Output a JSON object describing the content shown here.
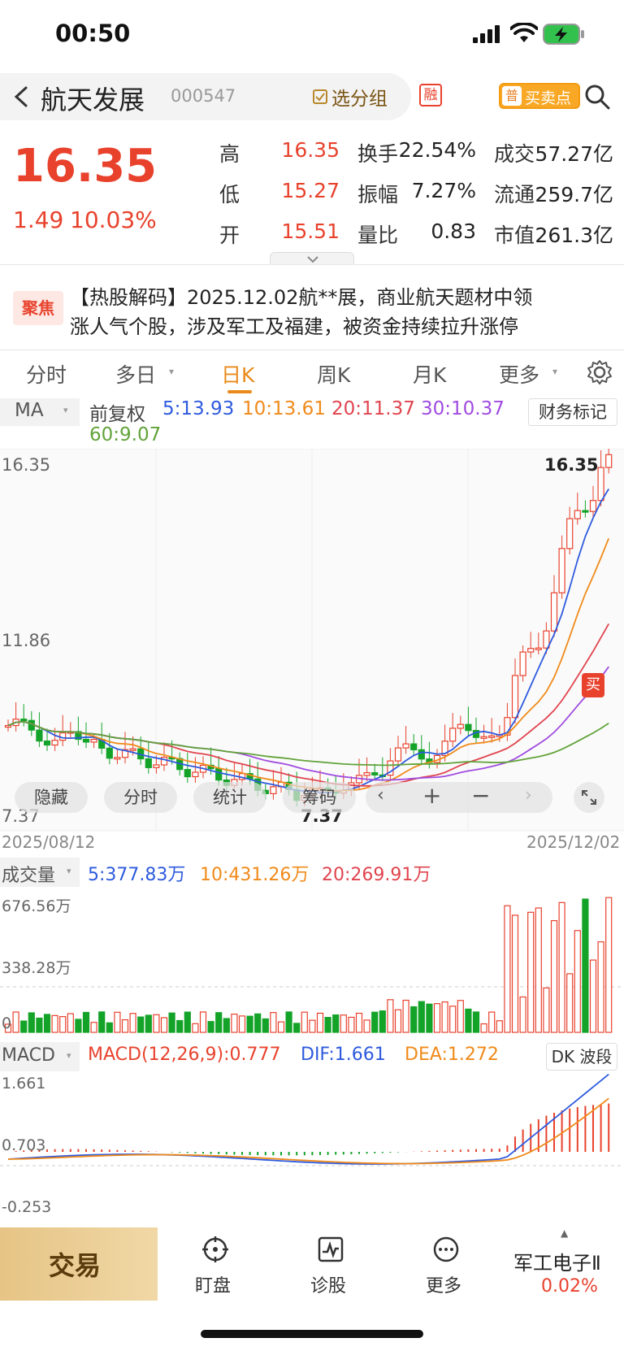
{
  "status_bar": {
    "time": "00:50"
  },
  "header": {
    "stock_name": "航天发展",
    "stock_code": "000547",
    "add_group_label": "选分组",
    "margin_badge": "融",
    "buy_sell_prefix": "普",
    "buy_sell_label": "买卖点"
  },
  "quote": {
    "price": "16.35",
    "change": "1.49",
    "change_pct": "10.03%",
    "rows": [
      {
        "l1": "高",
        "v1": "16.35",
        "l2": "换手",
        "v2": "22.54%",
        "l3": "成交",
        "v3": "57.27亿"
      },
      {
        "l1": "低",
        "v1": "15.27",
        "l2": "振幅",
        "v2": "7.27%",
        "l3": "流通",
        "v3": "259.7亿"
      },
      {
        "l1": "开",
        "v1": "15.51",
        "l2": "量比",
        "v2": "0.83",
        "l3": "市值",
        "v3": "261.3亿"
      }
    ]
  },
  "news": {
    "badge": "聚焦",
    "line1": "【热股解码】2025.12.02航**展，商业航天题材中领",
    "line2": "涨人气个股，涉及军工及福建，被资金持续拉升涨停"
  },
  "tabs": [
    {
      "label": "分时",
      "active": false
    },
    {
      "label": "多日",
      "active": false,
      "dropdown": true
    },
    {
      "label": "日K",
      "active": true
    },
    {
      "label": "周K",
      "active": false
    },
    {
      "label": "月K",
      "active": false
    },
    {
      "label": "更多",
      "active": false,
      "dropdown": true
    }
  ],
  "ma_legend": {
    "selector": "MA",
    "adjust": "前复权",
    "ma5": "5:13.93",
    "ma10": "10:13.61",
    "ma20": "20:11.37",
    "ma30": "30:10.37",
    "ma60": "60:9.07",
    "finance_mark": "财务标记"
  },
  "kline": {
    "y_high": "16.35",
    "y_mid": "11.86",
    "y_low": "7.37",
    "max_label": "16.35",
    "min_label": "7.37",
    "date_start": "2025/08/12",
    "date_end": "2025/12/02",
    "buy_marker": "买",
    "overlay_buttons": [
      "隐藏",
      "分时",
      "统计",
      "筹码"
    ]
  },
  "volume": {
    "selector": "成交量",
    "ma5": "5:377.83万",
    "ma10": "10:431.26万",
    "ma20": "20:269.91万",
    "y_top": "676.56万",
    "y_mid": "338.28万",
    "y_bottom": "0"
  },
  "macd": {
    "selector": "MACD",
    "macd_label": "MACD(12,26,9):0.777",
    "dif_label": "DIF:1.661",
    "dea_label": "DEA:1.272",
    "dk_label": "DK 波段",
    "y_top": "1.661",
    "y_mid": "0.703",
    "y_bottom": "-0.253"
  },
  "bottom_nav": {
    "trade_label": "交易",
    "items": [
      {
        "label": "盯盘",
        "icon": "target-icon"
      },
      {
        "label": "诊股",
        "icon": "chart-pulse-icon"
      },
      {
        "label": "更多",
        "icon": "more-dots-icon"
      }
    ],
    "sector_name": "军工电子Ⅱ",
    "sector_pct": "0.02%"
  },
  "colors": {
    "up": "#e8422d",
    "down": "#14a329",
    "ma5": "#2e5bde",
    "ma10": "#f08a1a",
    "ma20": "#e0454f",
    "ma30": "#a04ce0",
    "ma60": "#62a33a",
    "accent_gold": "#e9c98d"
  }
}
